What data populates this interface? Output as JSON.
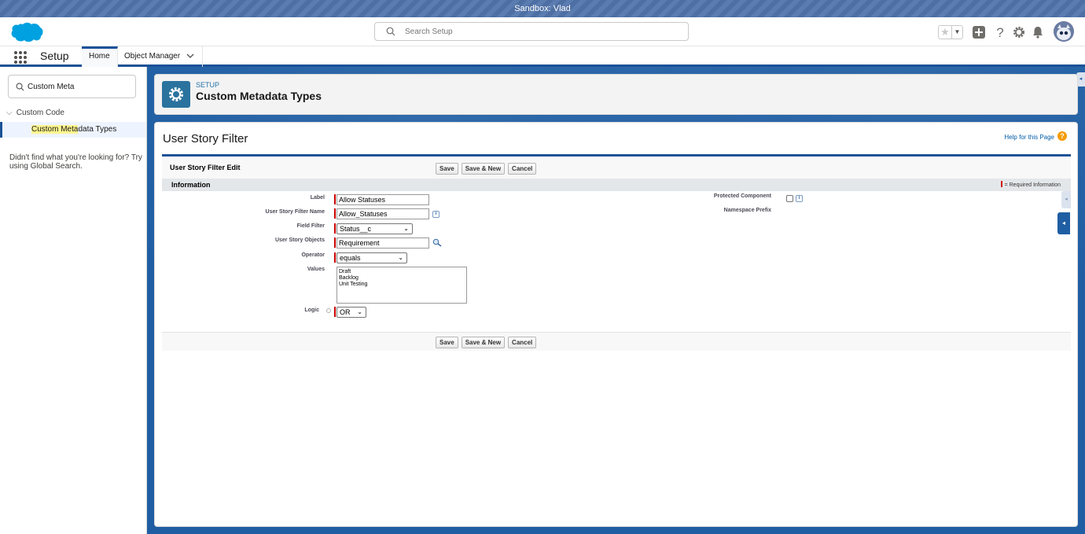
{
  "sandbox_banner": "Sandbox: Vlad",
  "header": {
    "search_placeholder": "Search Setup"
  },
  "context_bar": {
    "app_name": "Setup",
    "tabs": [
      {
        "label": "Home",
        "active": true
      },
      {
        "label": "Object Manager",
        "active": false
      }
    ]
  },
  "sidebar": {
    "quick_find_value": "Custom Meta",
    "tree_parent": "Custom Code",
    "tree_child_highlight": "Custom Meta",
    "tree_child_rest": "data Types",
    "not_found_text": "Didn't find what you're looking for? Try using Global Search."
  },
  "page_header": {
    "eyebrow": "SETUP",
    "title": "Custom Metadata Types"
  },
  "record": {
    "title": "User Story Filter",
    "help_link": "Help for this Page",
    "edit_title": "User Story Filter Edit",
    "buttons": {
      "save": "Save",
      "save_new": "Save & New",
      "cancel": "Cancel"
    },
    "section_title": "Information",
    "required_legend": "= Required Information",
    "fields": {
      "label": {
        "label": "Label",
        "value": "Allow Statuses"
      },
      "api_name": {
        "label": "User Story Filter Name",
        "value": "Allow_Statuses"
      },
      "field_filter": {
        "label": "Field Filter",
        "value": "Status__c"
      },
      "objects": {
        "label": "User Story Objects",
        "value": "Requirement"
      },
      "operator": {
        "label": "Operator",
        "value": "equals"
      },
      "values": {
        "label": "Values",
        "lines": [
          "Draft",
          "Backlog",
          "Unit Testing"
        ]
      },
      "logic": {
        "label": "Logic",
        "value": "OR"
      },
      "protected": {
        "label": "Protected Component",
        "checked": false
      },
      "namespace": {
        "label": "Namespace Prefix",
        "value": ""
      }
    }
  },
  "colors": {
    "brand_blue": "#1b5297",
    "required_red": "#cc0000",
    "setup_icon": "#2a739e"
  }
}
